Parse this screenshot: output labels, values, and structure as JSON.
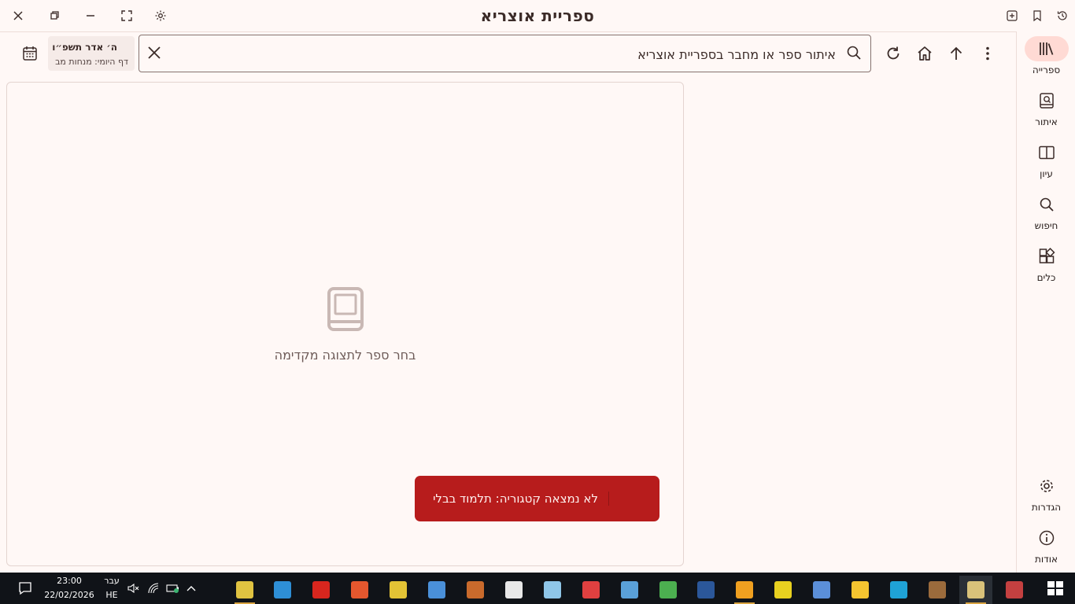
{
  "window": {
    "title": "ספריית אוצריא",
    "controls": {
      "close": "close-icon",
      "restore": "restore-icon",
      "minimize": "minimize-icon",
      "fullscreen": "fullscreen-icon",
      "settings": "gear-icon",
      "history": "history-icon",
      "bookmarks": "bookmark-icon",
      "new_tab": "add-tab-icon"
    }
  },
  "nav_rail": {
    "items": [
      {
        "label": "ספרייה",
        "icon": "library-icon",
        "active": true
      },
      {
        "label": "איתור",
        "icon": "find-book-icon"
      },
      {
        "label": "עיון",
        "icon": "open-book-icon"
      },
      {
        "label": "חיפוש",
        "icon": "search-icon"
      },
      {
        "label": "כלים",
        "icon": "tools-icon"
      }
    ],
    "bottom_items": [
      {
        "label": "הגדרות",
        "icon": "gear-icon"
      },
      {
        "label": "אודות",
        "icon": "info-icon"
      }
    ]
  },
  "toolbar": {
    "search_placeholder": "איתור ספר או מחבר בספריית אוצריא",
    "search_value": "",
    "date_hebrew": "ה׳ אדר תשפ״ו",
    "daf_yomi": "דף היומי: מנחות מב"
  },
  "preview": {
    "empty_text": "בחר ספר לתצוגה מקדימה"
  },
  "snackbar": {
    "message": "לא נמצאה קטגוריה: תלמוד בבלי"
  },
  "taskbar": {
    "time": "23:00",
    "date": "22/02/2026",
    "lang_name": "עבר",
    "lang_code": "HE",
    "apps": [
      {
        "name": "torah-app",
        "color": "#e0c341"
      },
      {
        "name": "kitvei-app",
        "color": "#2e8fd6"
      },
      {
        "name": "pdf-reader",
        "color": "#d8261e"
      },
      {
        "name": "firefox",
        "color": "#e4572e"
      },
      {
        "name": "people-app",
        "color": "#e3c335"
      },
      {
        "name": "audio-app",
        "color": "#4a90d9"
      },
      {
        "name": "books-app",
        "color": "#c96a2c"
      },
      {
        "name": "security-app",
        "color": "#e8e8e8"
      },
      {
        "name": "notes-app",
        "color": "#8fc6e8"
      },
      {
        "name": "video-app",
        "color": "#e04040"
      },
      {
        "name": "tools-app",
        "color": "#5aa0d8"
      },
      {
        "name": "chrome",
        "color": "#4caf50"
      },
      {
        "name": "word",
        "color": "#2b579a"
      },
      {
        "name": "search-app",
        "color": "#f0a020"
      },
      {
        "name": "pdf-app",
        "color": "#e8d020"
      },
      {
        "name": "font-app",
        "color": "#5b8fd8"
      },
      {
        "name": "file-explorer",
        "color": "#f4c430"
      },
      {
        "name": "edge",
        "color": "#1fa2d6"
      },
      {
        "name": "library-app",
        "color": "#9b6b3c"
      },
      {
        "name": "otzaria",
        "color": "#d9c27a"
      },
      {
        "name": "reader-app",
        "color": "#c44040"
      }
    ]
  }
}
